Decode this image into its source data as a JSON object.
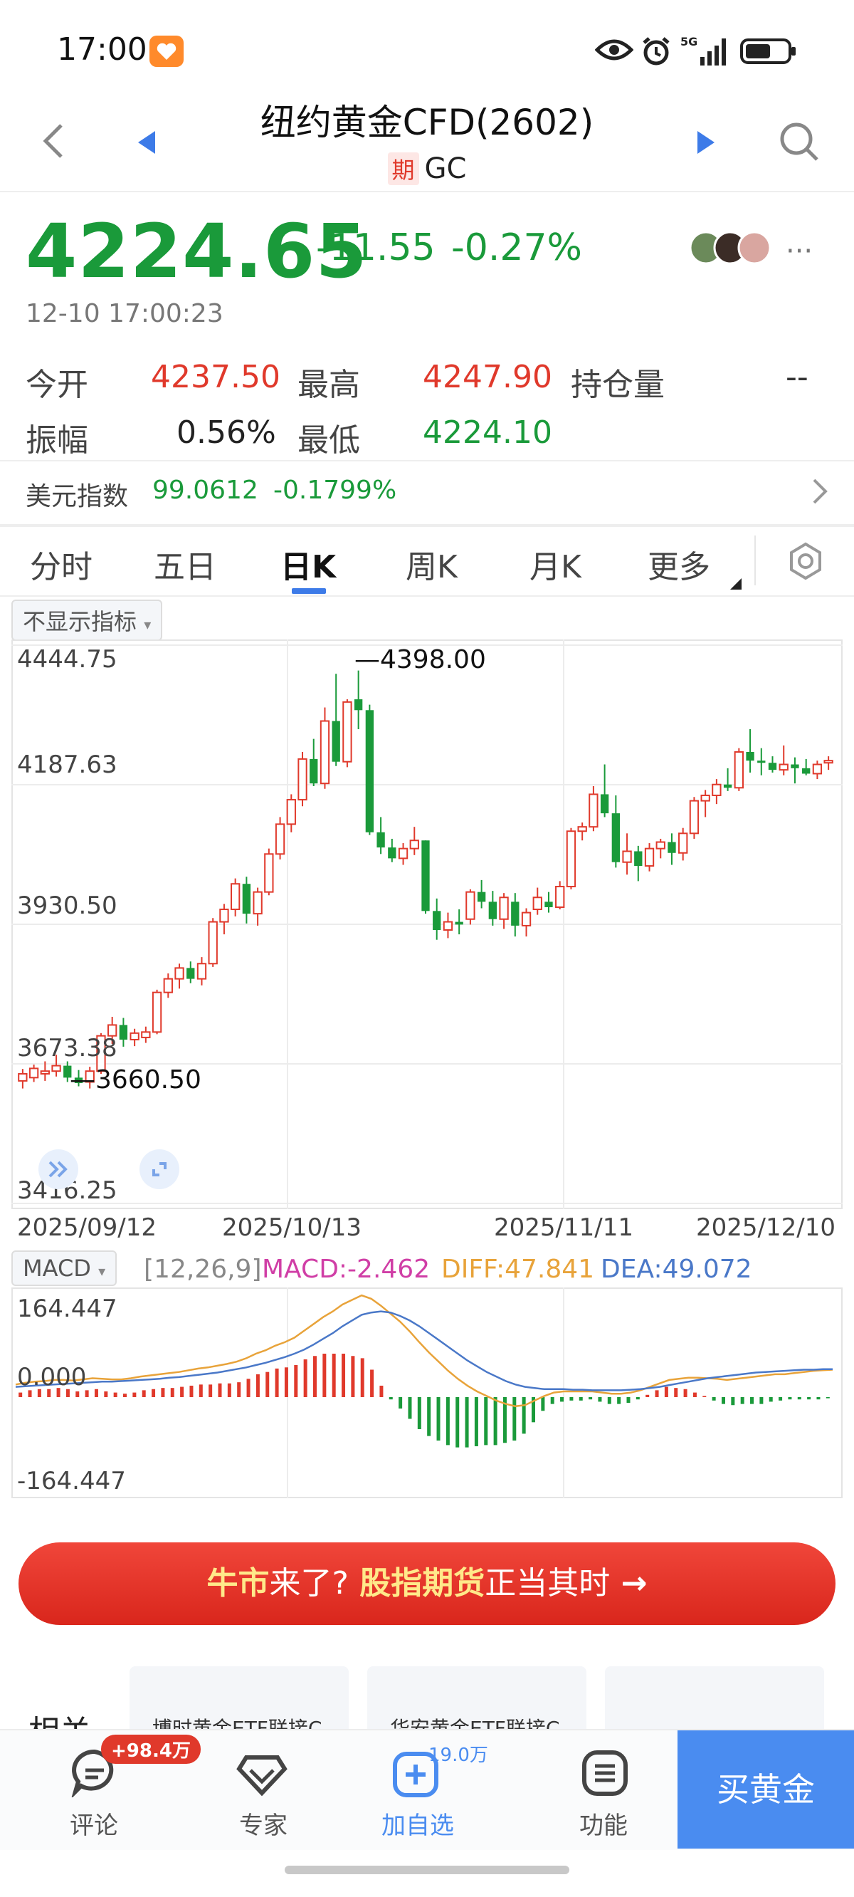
{
  "status_bar": {
    "time": "17:00",
    "network": "5G"
  },
  "header": {
    "title": "纽约黄金CFD(2602)",
    "badge": "期",
    "code": "GC"
  },
  "quote": {
    "price": "4224.65",
    "change": "-11.55",
    "change_pct": "-0.27%",
    "datetime": "12-10 17:00:23"
  },
  "stats": {
    "open_label": "今开",
    "open_value": "4237.50",
    "high_label": "最高",
    "high_value": "4247.90",
    "oi_label": "持仓量",
    "oi_value": "--",
    "amp_label": "振幅",
    "amp_value": "0.56%",
    "low_label": "最低",
    "low_value": "4224.10"
  },
  "usd_index": {
    "label": "美元指数",
    "value": "99.0612",
    "change": "-0.1799%"
  },
  "tabs": [
    "分时",
    "五日",
    "日K",
    "周K",
    "月K",
    "更多"
  ],
  "indicator_dropdown": "不显示指标",
  "chart_data": {
    "type": "candlestick",
    "y_ticks": [
      "4444.75",
      "4187.63",
      "3930.50",
      "3673.38",
      "3416.25"
    ],
    "ylim": [
      3416.25,
      4444.75
    ],
    "x_ticks": [
      "2025/09/12",
      "2025/10/13",
      "2025/11/11",
      "2025/12/10"
    ],
    "high_annotation": "4398.00",
    "low_annotation": "3660.50",
    "ohlc": [
      [
        3642,
        3664,
        3628,
        3655
      ],
      [
        3648,
        3672,
        3640,
        3665
      ],
      [
        3655,
        3678,
        3642,
        3660
      ],
      [
        3660,
        3690,
        3650,
        3670
      ],
      [
        3670,
        3678,
        3640,
        3648
      ],
      [
        3648,
        3662,
        3632,
        3638
      ],
      [
        3640,
        3668,
        3628,
        3660
      ],
      [
        3660,
        3730,
        3655,
        3725
      ],
      [
        3725,
        3760,
        3710,
        3745
      ],
      [
        3745,
        3758,
        3705,
        3718
      ],
      [
        3718,
        3738,
        3706,
        3730
      ],
      [
        3722,
        3742,
        3712,
        3732
      ],
      [
        3732,
        3810,
        3728,
        3805
      ],
      [
        3805,
        3840,
        3795,
        3830
      ],
      [
        3830,
        3858,
        3812,
        3850
      ],
      [
        3850,
        3862,
        3822,
        3830
      ],
      [
        3830,
        3870,
        3818,
        3858
      ],
      [
        3858,
        3942,
        3852,
        3935
      ],
      [
        3935,
        3968,
        3912,
        3958
      ],
      [
        3958,
        4015,
        3945,
        4005
      ],
      [
        4005,
        4018,
        3932,
        3950
      ],
      [
        3950,
        3998,
        3928,
        3990
      ],
      [
        3990,
        4070,
        3984,
        4060
      ],
      [
        4060,
        4128,
        4050,
        4115
      ],
      [
        4115,
        4170,
        4100,
        4160
      ],
      [
        4160,
        4248,
        4148,
        4235
      ],
      [
        4235,
        4272,
        4185,
        4190
      ],
      [
        4190,
        4330,
        4180,
        4305
      ],
      [
        4305,
        4392,
        4222,
        4230
      ],
      [
        4230,
        4345,
        4220,
        4340
      ],
      [
        4345,
        4398,
        4290,
        4325
      ],
      [
        4325,
        4335,
        4095,
        4100
      ],
      [
        4100,
        4128,
        4060,
        4072
      ],
      [
        4072,
        4088,
        4045,
        4052
      ],
      [
        4052,
        4080,
        4040,
        4070
      ],
      [
        4070,
        4110,
        4058,
        4085
      ],
      [
        4085,
        4085,
        3950,
        3955
      ],
      [
        3955,
        3978,
        3902,
        3920
      ],
      [
        3920,
        3952,
        3905,
        3935
      ],
      [
        3935,
        3958,
        3912,
        3930
      ],
      [
        3940,
        3995,
        3930,
        3990
      ],
      [
        3990,
        4012,
        3960,
        3972
      ],
      [
        3972,
        3992,
        3928,
        3940
      ],
      [
        3940,
        3988,
        3922,
        3980
      ],
      [
        3972,
        3988,
        3908,
        3928
      ],
      [
        3928,
        3960,
        3908,
        3952
      ],
      [
        3958,
        3998,
        3948,
        3980
      ],
      [
        3972,
        3990,
        3952,
        3962
      ],
      [
        3962,
        4010,
        3958,
        4000
      ],
      [
        4000,
        4108,
        3995,
        4102
      ],
      [
        4102,
        4118,
        4085,
        4110
      ],
      [
        4110,
        4185,
        4102,
        4170
      ],
      [
        4170,
        4225,
        4128,
        4135
      ],
      [
        4135,
        4168,
        4035,
        4045
      ],
      [
        4045,
        4098,
        4022,
        4065
      ],
      [
        4065,
        4075,
        4010,
        4038
      ],
      [
        4038,
        4080,
        4028,
        4070
      ],
      [
        4070,
        4088,
        4052,
        4082
      ],
      [
        4082,
        4098,
        4040,
        4062
      ],
      [
        4062,
        4108,
        4048,
        4098
      ],
      [
        4098,
        4165,
        4088,
        4158
      ],
      [
        4158,
        4178,
        4128,
        4168
      ],
      [
        4168,
        4198,
        4152,
        4188
      ],
      [
        4188,
        4218,
        4176,
        4182
      ],
      [
        4182,
        4255,
        4176,
        4248
      ],
      [
        4248,
        4290,
        4210,
        4232
      ],
      [
        4232,
        4255,
        4205,
        4228
      ],
      [
        4228,
        4240,
        4210,
        4215
      ],
      [
        4215,
        4260,
        4205,
        4225
      ],
      [
        4225,
        4238,
        4190,
        4218
      ],
      [
        4218,
        4235,
        4205,
        4208
      ],
      [
        4208,
        4232,
        4198,
        4225
      ],
      [
        4228,
        4240,
        4215,
        4232
      ]
    ],
    "macd": {
      "label": "MACD",
      "params": "[12,26,9]",
      "macd_label": "MACD:",
      "macd_value": "-2.462",
      "diff_label": "DIFF:",
      "diff_value": "47.841",
      "dea_label": "DEA:",
      "dea_value": "49.072",
      "y_ticks": [
        "164.447",
        "0.000",
        "-164.447"
      ],
      "ylim": [
        -164.447,
        164.447
      ],
      "diff_color": "#e8a33a",
      "dea_color": "#4a78c8",
      "macd_color": "#d9a0d0",
      "diff": [
        22,
        25,
        27,
        28,
        30,
        30,
        29,
        31,
        33,
        32,
        31,
        31,
        33,
        36,
        38,
        40,
        42,
        44,
        47,
        50,
        52,
        55,
        58,
        62,
        68,
        76,
        82,
        90,
        96,
        104,
        116,
        128,
        140,
        150,
        162,
        170,
        178,
        172,
        160,
        146,
        132,
        115,
        96,
        78,
        62,
        46,
        32,
        20,
        10,
        2,
        -6,
        -12,
        -16,
        -14,
        -6,
        2,
        8,
        10,
        10,
        10,
        10,
        8,
        6,
        6,
        8,
        12,
        18,
        24,
        30,
        32,
        34,
        34,
        33,
        32,
        30,
        32,
        34,
        36,
        38,
        40,
        40,
        42,
        44,
        46,
        47,
        48
      ],
      "dea": [
        18,
        19,
        20,
        21,
        22,
        23,
        24,
        25,
        26,
        27,
        27,
        28,
        29,
        30,
        31,
        32,
        34,
        35,
        37,
        39,
        41,
        43,
        46,
        49,
        52,
        56,
        60,
        65,
        70,
        76,
        83,
        92,
        102,
        112,
        124,
        134,
        144,
        148,
        150,
        148,
        142,
        134,
        124,
        112,
        100,
        88,
        76,
        64,
        54,
        44,
        36,
        28,
        22,
        18,
        16,
        14,
        14,
        14,
        13,
        13,
        12,
        12,
        12,
        12,
        13,
        14,
        16,
        18,
        21,
        24,
        27,
        30,
        33,
        35,
        37,
        39,
        41,
        43,
        44,
        45,
        46,
        47,
        48,
        48,
        49,
        49
      ],
      "hist": [
        8,
        12,
        14,
        14,
        16,
        14,
        10,
        12,
        14,
        10,
        8,
        6,
        8,
        12,
        14,
        16,
        16,
        18,
        20,
        22,
        22,
        24,
        24,
        26,
        32,
        40,
        44,
        50,
        52,
        56,
        66,
        72,
        76,
        76,
        76,
        72,
        68,
        48,
        20,
        -4,
        -20,
        -38,
        -56,
        -68,
        -76,
        -84,
        -88,
        -88,
        -86,
        -84,
        -84,
        -80,
        -76,
        -64,
        -44,
        -24,
        -12,
        -8,
        -6,
        -6,
        -4,
        -8,
        -12,
        -12,
        -10,
        -4,
        4,
        12,
        18,
        16,
        14,
        8,
        2,
        -6,
        -12,
        -14,
        -12,
        -12,
        -12,
        -8,
        -6,
        -4,
        -4,
        -4,
        -4,
        -2
      ]
    }
  },
  "banner": {
    "part1": "牛市",
    "part2": "来了?",
    "part3": "股指期货",
    "part4": "正当其时",
    "arrow": "→"
  },
  "related": {
    "title": "相关",
    "cards": [
      "博时黄金ETF联接C",
      "华安黄金ETF联接C",
      ""
    ]
  },
  "bottom_nav": {
    "comment_label": "评论",
    "comment_badge": "+98.4万",
    "expert_label": "专家",
    "watch_label": "加自选",
    "watch_count": "19.0万",
    "func_label": "功能",
    "buy_label": "买黄金"
  },
  "colors": {
    "up": "#e0392b",
    "down": "#1a9a3a",
    "accent": "#3d7be8",
    "buy": "#4a8cf0"
  }
}
